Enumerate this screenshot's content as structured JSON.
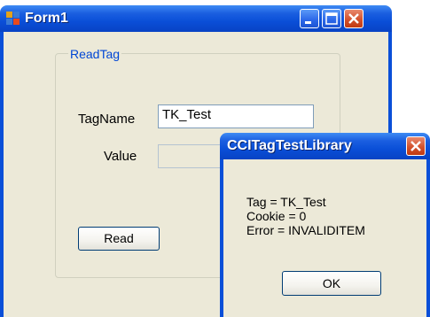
{
  "form1": {
    "title": "Form1",
    "group_label": "ReadTag",
    "tagname_label": "TagName",
    "tagname_value": "TK_Test",
    "value_label": "Value",
    "value_value": "",
    "read_button": "Read"
  },
  "messagebox": {
    "title": "CCITagTestLibrary",
    "lines": [
      "Tag = TK_Test",
      "Cookie = 0",
      "Error = INVALIDITEM"
    ],
    "ok_button": "OK"
  },
  "colors": {
    "titlebar": "#0a4fd8",
    "dialog_bg": "#ece9d8",
    "group_label": "#0046d5",
    "close_red": "#d24e28"
  },
  "icons": [
    "app-icon",
    "minimize-icon",
    "maximize-icon",
    "close-icon"
  ]
}
